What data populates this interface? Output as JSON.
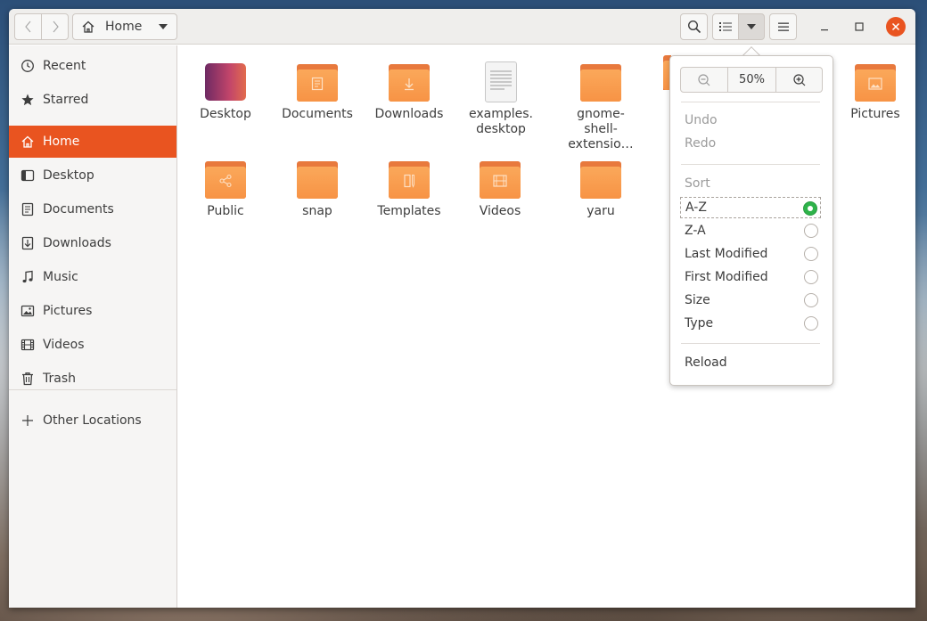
{
  "headerbar": {
    "path_label": "Home"
  },
  "sidebar": {
    "items": [
      {
        "label": "Recent",
        "icon": "clock-icon"
      },
      {
        "label": "Starred",
        "icon": "star-icon"
      },
      {
        "label": "Home",
        "icon": "home-icon",
        "active": true
      },
      {
        "label": "Desktop",
        "icon": "desktop-icon"
      },
      {
        "label": "Documents",
        "icon": "document-icon"
      },
      {
        "label": "Downloads",
        "icon": "download-icon"
      },
      {
        "label": "Music",
        "icon": "music-note-icon"
      },
      {
        "label": "Pictures",
        "icon": "image-icon"
      },
      {
        "label": "Videos",
        "icon": "film-icon"
      },
      {
        "label": "Trash",
        "icon": "trash-icon"
      }
    ],
    "other_locations": "Other Locations"
  },
  "files": [
    {
      "name": "Desktop",
      "type": "desktop-folder"
    },
    {
      "name": "Documents",
      "type": "folder-documents"
    },
    {
      "name": "Downloads",
      "type": "folder-downloads"
    },
    {
      "name": "examples.\ndesktop",
      "type": "text-file"
    },
    {
      "name": "gnome-\nshell-\nextensio…",
      "type": "folder"
    },
    {
      "name": "Pictures",
      "type": "folder-pictures"
    },
    {
      "name": "Public",
      "type": "folder-public"
    },
    {
      "name": "snap",
      "type": "folder"
    },
    {
      "name": "Templates",
      "type": "folder-templates"
    },
    {
      "name": "Videos",
      "type": "folder-videos"
    },
    {
      "name": "yaru",
      "type": "folder"
    }
  ],
  "view_menu": {
    "zoom_level": "50%",
    "undo": "Undo",
    "redo": "Redo",
    "sort_heading": "Sort",
    "sort_options": [
      {
        "label": "A-Z",
        "checked": true
      },
      {
        "label": "Z-A",
        "checked": false
      },
      {
        "label": "Last Modified",
        "checked": false
      },
      {
        "label": "First Modified",
        "checked": false
      },
      {
        "label": "Size",
        "checked": false
      },
      {
        "label": "Type",
        "checked": false
      }
    ],
    "reload": "Reload"
  },
  "colors": {
    "accent": "#e95420",
    "folder": "#f79345",
    "radio_checked": "#2eb34a"
  }
}
